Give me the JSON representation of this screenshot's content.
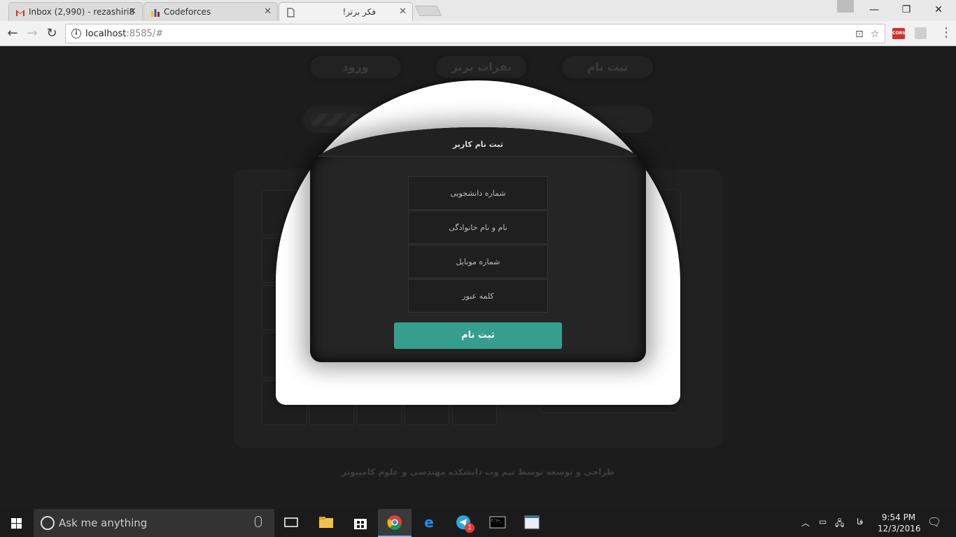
{
  "browser": {
    "tabs": [
      {
        "title": "Inbox (2,990) - rezashiri8",
        "favicon": "gmail-icon",
        "active": false
      },
      {
        "title": "Codeforces",
        "favicon": "codeforces-icon",
        "active": false
      },
      {
        "title": "!فکر برتر",
        "favicon": "document-icon",
        "active": true
      }
    ],
    "url_host": "localhost",
    "url_rest": ":8585/#"
  },
  "site": {
    "nav": {
      "register": "ثبت نام",
      "top_players": "نفرات برتر",
      "login": "ورود"
    },
    "footer": "طراحی و توسعه توسط تیم وب دانشکده مهندسی و علوم کامپیوتر"
  },
  "modal": {
    "title": "ثبت نام کاربر",
    "fields": {
      "student_id": "شماره دانشجویی",
      "full_name": "نام و نام خانوادگی",
      "mobile": "شماره موبایل",
      "password": "کلمه عبور"
    },
    "submit_label": "ثبت نام",
    "accent_color": "#369e8d"
  },
  "taskbar": {
    "search_placeholder": "Ask me anything",
    "telegram_badge": "1",
    "language": "فا",
    "time": "9:54 PM",
    "date": "12/3/2016"
  }
}
